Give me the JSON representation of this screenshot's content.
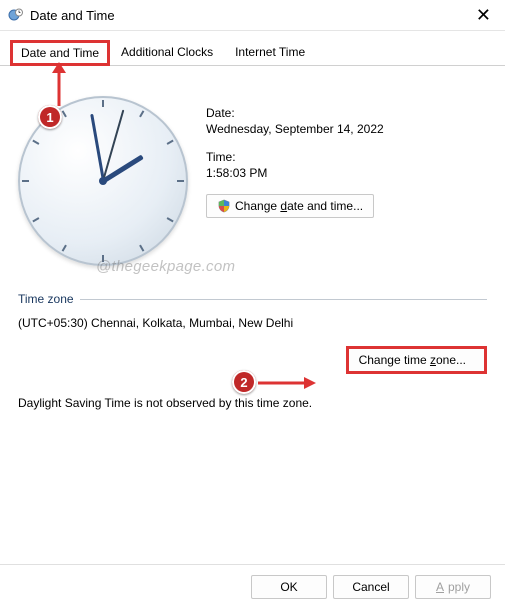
{
  "window": {
    "title": "Date and Time"
  },
  "tabs": {
    "date_time": "Date and Time",
    "additional_clocks": "Additional Clocks",
    "internet_time": "Internet Time"
  },
  "labels": {
    "date": "Date:",
    "time": "Time:",
    "timezone_section": "Time zone"
  },
  "values": {
    "date": "Wednesday, September 14, 2022",
    "time": "1:58:03 PM",
    "timezone": "(UTC+05:30) Chennai, Kolkata, Mumbai, New Delhi"
  },
  "buttons": {
    "change_date_prefix": "Change ",
    "change_date_u": "d",
    "change_date_suffix": "ate and time...",
    "change_tz_prefix": "Change time ",
    "change_tz_u": "z",
    "change_tz_suffix": "one...",
    "ok": "OK",
    "cancel": "Cancel",
    "apply_u": "A",
    "apply_suffix": "pply"
  },
  "dst": "Daylight Saving Time is not observed by this time zone.",
  "watermark": "@thegeekpage.com",
  "callouts": {
    "one": "1",
    "two": "2"
  }
}
